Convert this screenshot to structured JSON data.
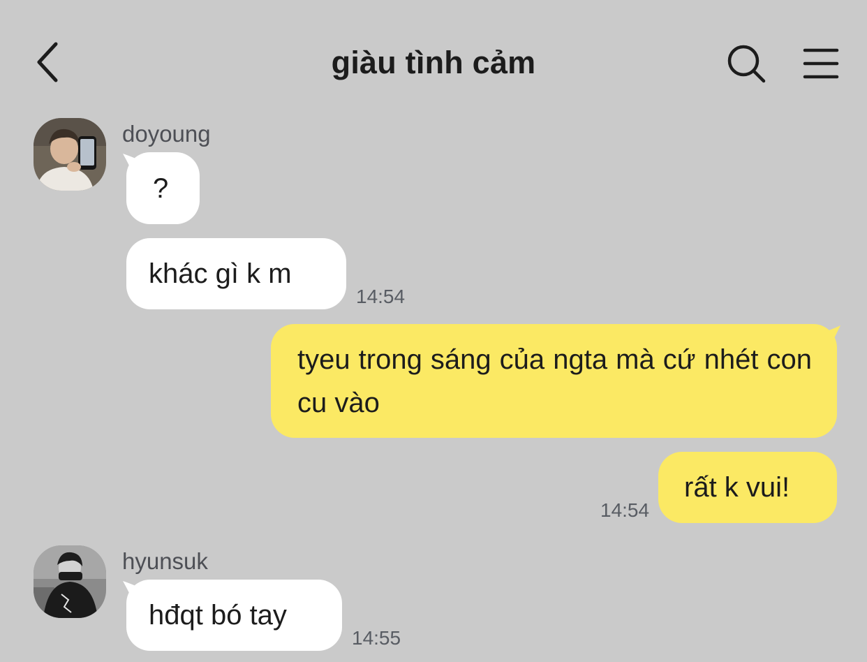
{
  "header": {
    "title": "giàu tình cảm",
    "back_icon": "chevron-left-icon",
    "search_icon": "search-icon",
    "menu_icon": "hamburger-menu-icon"
  },
  "colors": {
    "background": "#cacaca",
    "incoming_bubble": "#ffffff",
    "outgoing_bubble": "#fbe964",
    "text": "#1c1c1c",
    "meta_text": "#585c63"
  },
  "messages": [
    {
      "sender": "doyoung",
      "direction": "incoming",
      "bubbles": [
        {
          "text": "?"
        },
        {
          "text": "khác gì k m",
          "time": "14:54"
        }
      ]
    },
    {
      "sender": "me",
      "direction": "outgoing",
      "bubbles": [
        {
          "text": "tyeu trong sáng của ngta mà cứ nhét con cu vào"
        },
        {
          "text": "rất k vui!",
          "time": "14:54"
        }
      ]
    },
    {
      "sender": "hyunsuk",
      "direction": "incoming",
      "bubbles": [
        {
          "text": "hđqt bó tay",
          "time": "14:55"
        }
      ]
    }
  ]
}
